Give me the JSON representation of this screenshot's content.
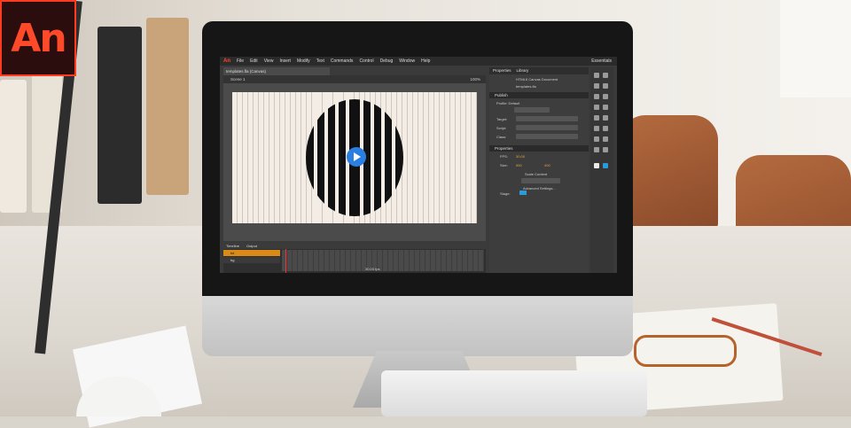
{
  "logo": {
    "text": "An",
    "color": "#ff4a2a",
    "border": "#ff3b1f"
  },
  "app": {
    "menu": [
      "File",
      "Edit",
      "View",
      "Insert",
      "Modify",
      "Text",
      "Commands",
      "Control",
      "Debug",
      "Window",
      "Help"
    ],
    "workspace": "Essentials",
    "document_tab": "templates.fla (Canvas)",
    "scene": "Scene 1",
    "zoom": "100%",
    "timeline_tabs": [
      "Timeline",
      "Output"
    ],
    "layers": [
      "txt",
      "bg"
    ],
    "timeline_fps": "30.00 fps",
    "panel_tabs": [
      "Properties",
      "Library"
    ],
    "doc_type": "HTML5 Canvas Document",
    "doc_name": "templates.fla",
    "publish_section": "Publish",
    "profile": "Profile: Default",
    "publish_settings": "Publish Settings...",
    "target_label": "Target:",
    "script_label": "Script:",
    "class_label": "Class:",
    "properties_section": "Properties",
    "fps_label": "FPS:",
    "fps_value": "30.00",
    "size_label": "Size:",
    "width": "550",
    "height": "400",
    "scale_content": "Scale Content",
    "advanced_settings": "Advanced Settings...",
    "stage_label": "Stage:",
    "stage_color": "#2a9ad8",
    "play_color": "#2a7fe0"
  }
}
